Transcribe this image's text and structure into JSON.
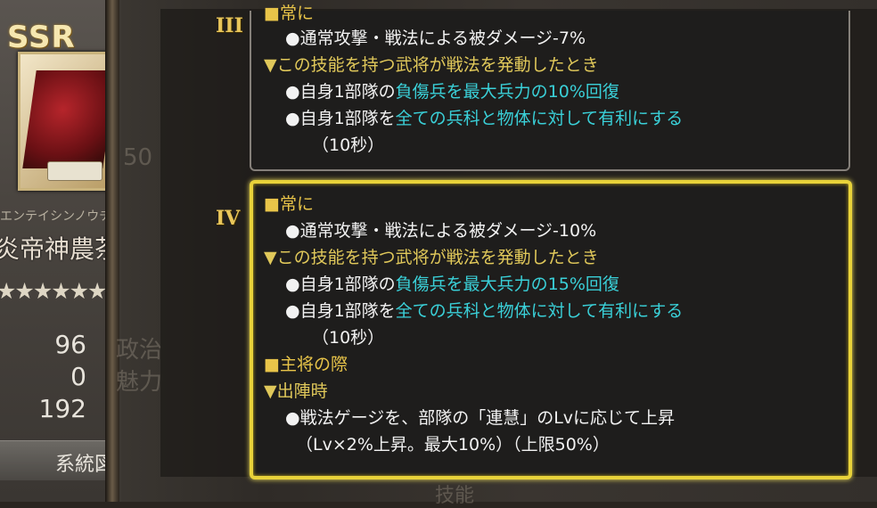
{
  "card": {
    "rarity": "SSR",
    "kana": "エンテイシンノウチャ",
    "name": "炎帝神農茶譜",
    "stars": "★★★★★★★★★",
    "stats": [
      "96",
      "0",
      "192"
    ],
    "stat_labels_faint": [
      "政治",
      "魅力"
    ],
    "level_faint": "50",
    "lineage_button": "系統図"
  },
  "levels": [
    {
      "roman": "III",
      "lines": [
        {
          "parts": [
            {
              "t": "■常に",
              "c": "y"
            }
          ]
        },
        {
          "parts": [
            {
              "t": "●通常攻撃・戦法による被ダメージ-7%",
              "c": "w"
            }
          ]
        },
        {
          "parts": [
            {
              "t": "▼この技能を持つ武将が戦法を発動したとき",
              "c": "ly"
            }
          ]
        },
        {
          "parts": [
            {
              "t": "●自身1部隊の",
              "c": "w"
            },
            {
              "t": "負傷兵を最大兵力の10%回復",
              "c": "c"
            }
          ]
        },
        {
          "parts": [
            {
              "t": "●自身1部隊を",
              "c": "w"
            },
            {
              "t": "全ての兵科と物体に対して有利にする",
              "c": "c"
            }
          ]
        },
        {
          "parts": [
            {
              "t": "（10秒）",
              "c": "w"
            }
          ]
        }
      ]
    },
    {
      "roman": "IV",
      "lines": [
        {
          "parts": [
            {
              "t": "■常に",
              "c": "y"
            }
          ]
        },
        {
          "parts": [
            {
              "t": "●通常攻撃・戦法による被ダメージ-10%",
              "c": "w"
            }
          ]
        },
        {
          "parts": [
            {
              "t": "▼この技能を持つ武将が戦法を発動したとき",
              "c": "ly"
            }
          ]
        },
        {
          "parts": [
            {
              "t": "●自身1部隊の",
              "c": "w"
            },
            {
              "t": "負傷兵を最大兵力の15%回復",
              "c": "c"
            }
          ]
        },
        {
          "parts": [
            {
              "t": "●自身1部隊を",
              "c": "w"
            },
            {
              "t": "全ての兵科と物体に対して有利にする",
              "c": "c"
            }
          ]
        },
        {
          "parts": [
            {
              "t": "（10秒）",
              "c": "w"
            }
          ]
        },
        {
          "parts": [
            {
              "t": "■主将の際",
              "c": "y"
            }
          ]
        },
        {
          "parts": [
            {
              "t": "▼出陣時",
              "c": "ly"
            }
          ]
        },
        {
          "parts": [
            {
              "t": "●戦法ゲージを、部隊の「連慧」のLvに応じて上昇",
              "c": "w"
            }
          ]
        },
        {
          "parts": [
            {
              "t": "（Lv×2%上昇。最大10%）（上限50%）",
              "c": "w"
            }
          ]
        }
      ]
    }
  ],
  "background_tab": "技能"
}
